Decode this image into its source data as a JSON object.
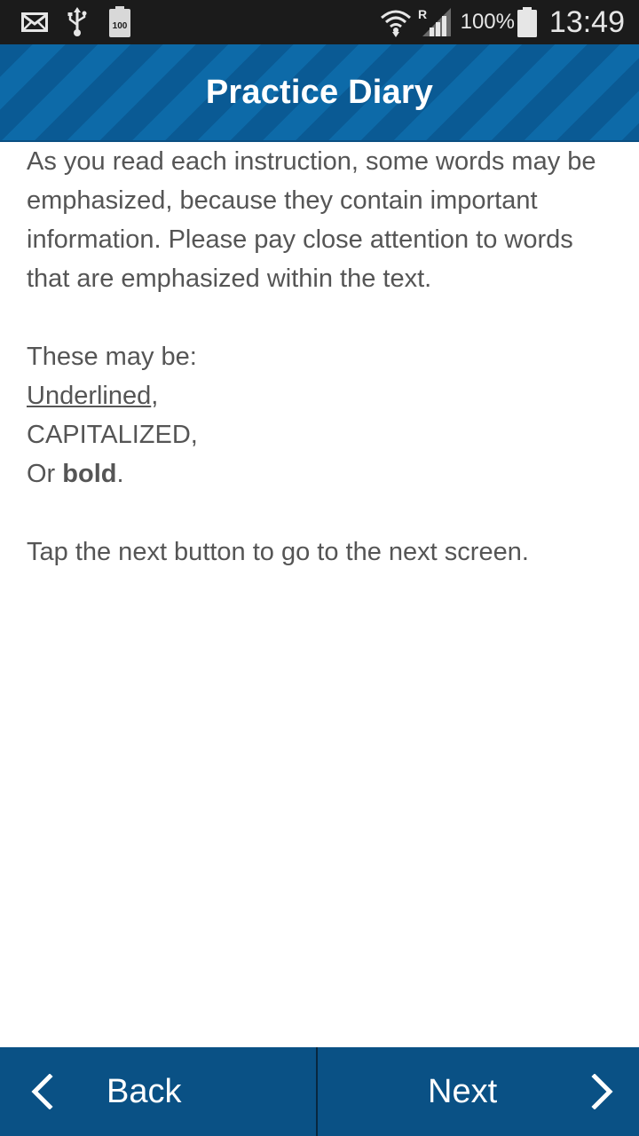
{
  "status_bar": {
    "icons": [
      "mail-icon",
      "usb-icon",
      "battery-100-badge-icon",
      "wifi-icon",
      "signal-icon",
      "battery-icon"
    ],
    "roaming_marker": "R",
    "battery_badge": "100",
    "battery_percent": "100%",
    "time": "13:49"
  },
  "header": {
    "title": "Practice Diary"
  },
  "content": {
    "intro": "As you read each instruction, some words may be emphasized, because they contain important information. Please pay close attention to words that are emphasized within the text.",
    "list_intro": "These may be:",
    "underlined_word": "Underlined",
    "underlined_suffix": ",",
    "capitalized_line": "CAPITALIZED,",
    "bold_prefix": "Or ",
    "bold_word": "bold",
    "bold_suffix": ".",
    "instruction": "Tap the next button to go to the next screen."
  },
  "nav": {
    "back_label": "Back",
    "next_label": "Next",
    "back_icon": "chevron-left-icon",
    "next_icon": "chevron-right-icon"
  },
  "colors": {
    "status_bar_bg": "#1b1b1b",
    "header_bg": "#0a5a94",
    "header_stripe": "#0d6aa8",
    "nav_bg": "#0a5185",
    "body_text": "#555555"
  }
}
